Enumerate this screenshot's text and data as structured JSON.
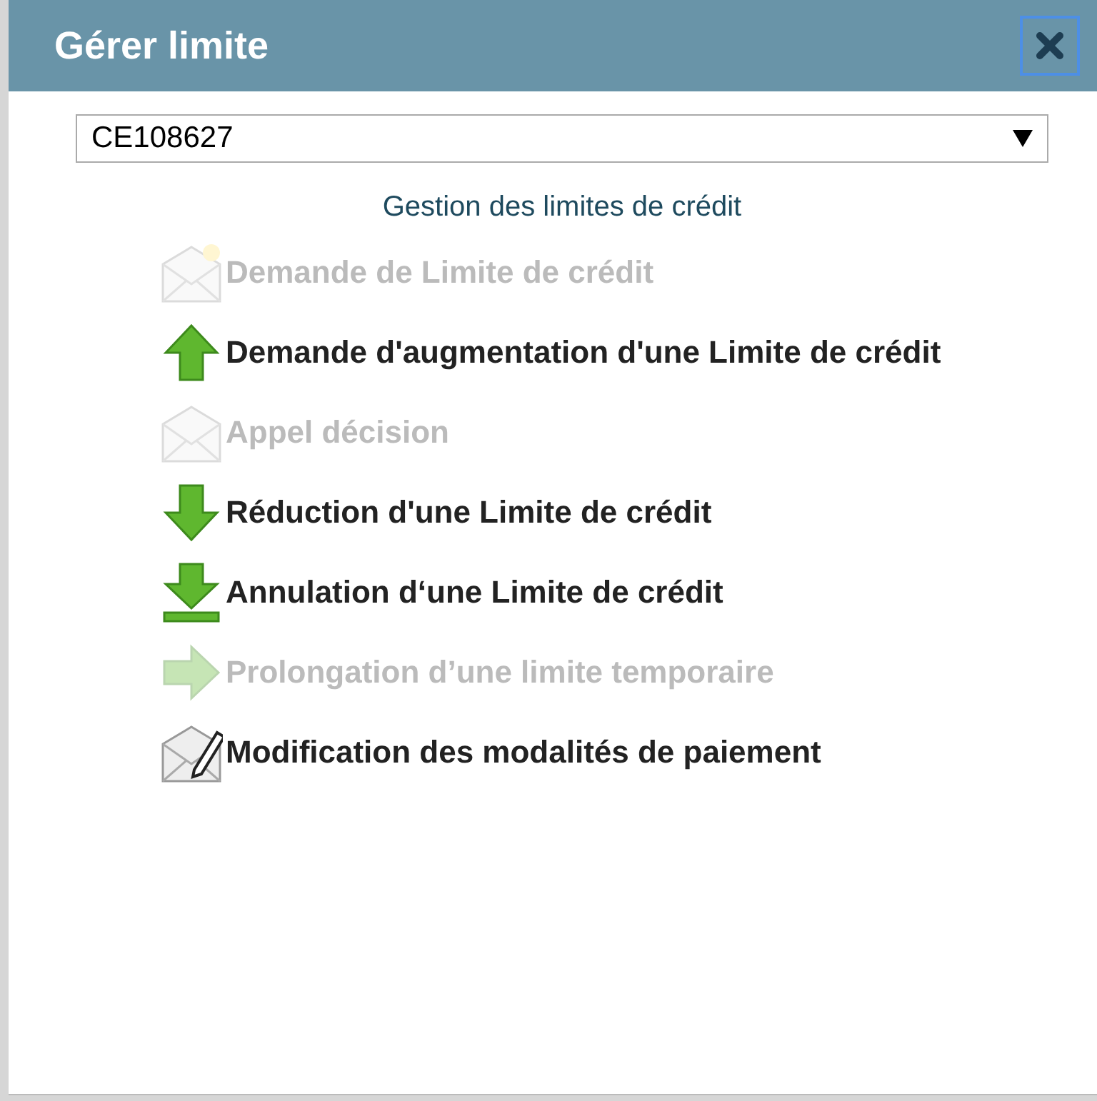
{
  "dialog": {
    "title": "Gérer limite"
  },
  "select": {
    "value": "CE108627"
  },
  "section_title": "Gestion des limites de crédit",
  "actions": [
    {
      "kind": "envelope-star",
      "label": "Demande de Limite de crédit",
      "disabled": true
    },
    {
      "kind": "arrow-up",
      "label": "Demande d'augmentation d'une Limite de crédit",
      "disabled": false
    },
    {
      "kind": "envelope",
      "label": "Appel décision",
      "disabled": true
    },
    {
      "kind": "arrow-down",
      "label": "Réduction d'une Limite de crédit",
      "disabled": false
    },
    {
      "kind": "arrow-down-bar",
      "label": "Annulation d‘une Limite de crédit",
      "disabled": false
    },
    {
      "kind": "arrow-right",
      "label": "Prolongation d’une limite temporaire",
      "disabled": true
    },
    {
      "kind": "envelope-pencil",
      "label": "Modification des modalités de paiement",
      "disabled": false
    }
  ]
}
